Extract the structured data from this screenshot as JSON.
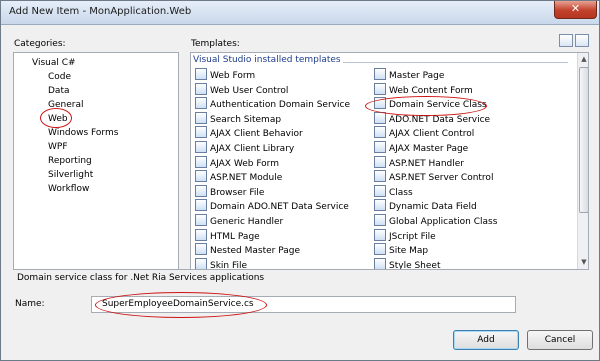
{
  "window": {
    "title": "Add New Item - MonApplication.Web",
    "close_glyph": "✕"
  },
  "categories": {
    "label": "Categories:",
    "root": "Visual C#",
    "items": [
      "Code",
      "Data",
      "General",
      "Web",
      "Windows Forms",
      "WPF",
      "Reporting",
      "Silverlight",
      "Workflow"
    ],
    "selected": "Web"
  },
  "templates": {
    "label": "Templates:",
    "group_heading": "Visual Studio installed templates",
    "left_column": [
      "Web Form",
      "Web User Control",
      "Authentication Domain Service",
      "Search Sitemap",
      "AJAX Client Behavior",
      "AJAX Client Library",
      "AJAX Web Form",
      "ASP.NET Module",
      "Browser File",
      "Domain ADO.NET Data Service",
      "Generic Handler",
      "HTML Page",
      "Nested Master Page",
      "Skin File"
    ],
    "right_column": [
      "Master Page",
      "Web Content Form",
      "Domain Service Class",
      "ADO.NET Data Service",
      "AJAX Client Control",
      "AJAX Master Page",
      "ASP.NET Handler",
      "ASP.NET Server Control",
      "Class",
      "Dynamic Data Field",
      "Global Application Class",
      "JScript File",
      "Site Map",
      "Style Sheet"
    ],
    "selected": "Domain Service Class"
  },
  "description": "Domain service class for .Net Ria Services applications",
  "name_field": {
    "label": "Name:",
    "value": "SuperEmployeeDomainService.cs"
  },
  "buttons": {
    "add": "Add",
    "cancel": "Cancel"
  },
  "colors": {
    "annotation": "#cc1111",
    "heading": "#1e3d8c"
  }
}
